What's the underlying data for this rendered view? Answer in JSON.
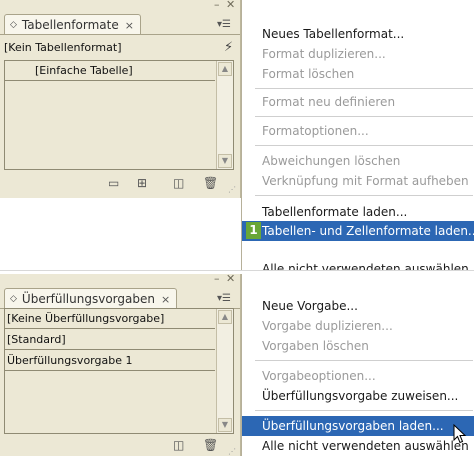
{
  "screens": [
    {
      "panel": {
        "tab_label": "Tabellenformate",
        "tab_close": "×",
        "style_rows": [
          "[Kein Tabellenformat]",
          "[Einfache Tabelle]"
        ]
      },
      "menu": {
        "items": [
          {
            "label": "Neues Tabellenformat...",
            "disabled": false
          },
          {
            "label": "Format duplizieren...",
            "disabled": true
          },
          {
            "label": "Format löschen",
            "disabled": true
          },
          {
            "label": "Format neu definieren",
            "disabled": true
          },
          {
            "label": "Formatoptionen...",
            "disabled": true
          },
          {
            "label": "Abweichungen löschen",
            "disabled": true
          },
          {
            "label": "Verknüpfung mit Format aufheben",
            "disabled": true
          },
          {
            "label": "Tabellenformate laden...",
            "disabled": false
          },
          {
            "label": "Tabellen- und Zellenformate laden...",
            "disabled": false,
            "highlighted": true
          },
          {
            "label": "Alle nicht verwendeten auswählen",
            "disabled": false,
            "partial": true
          }
        ],
        "step_badge": "1"
      }
    },
    {
      "panel": {
        "tab_label": "Überfüllungsvorgaben",
        "tab_close": "×",
        "preset_rows": [
          "[Keine Überfüllungsvorgabe]",
          "[Standard]",
          "Überfüllungsvorgabe 1"
        ]
      },
      "menu": {
        "items": [
          {
            "label": "Neue Vorgabe...",
            "disabled": false
          },
          {
            "label": "Vorgabe duplizieren...",
            "disabled": true
          },
          {
            "label": "Vorgaben löschen",
            "disabled": true
          },
          {
            "label": "Vorgabeoptionen...",
            "disabled": true
          },
          {
            "label": "Überfüllungsvorgabe zuweisen...",
            "disabled": false
          },
          {
            "label": "Überfüllungsvorgaben laden...",
            "disabled": false,
            "highlighted": true
          },
          {
            "label": "Alle nicht verwendeten auswählen",
            "disabled": false
          }
        ]
      }
    }
  ],
  "colors": {
    "panel_bg": "#ece8d5",
    "highlight": "#2c67b4",
    "badge": "#69a637",
    "disabled_text": "#9a9a9a"
  }
}
